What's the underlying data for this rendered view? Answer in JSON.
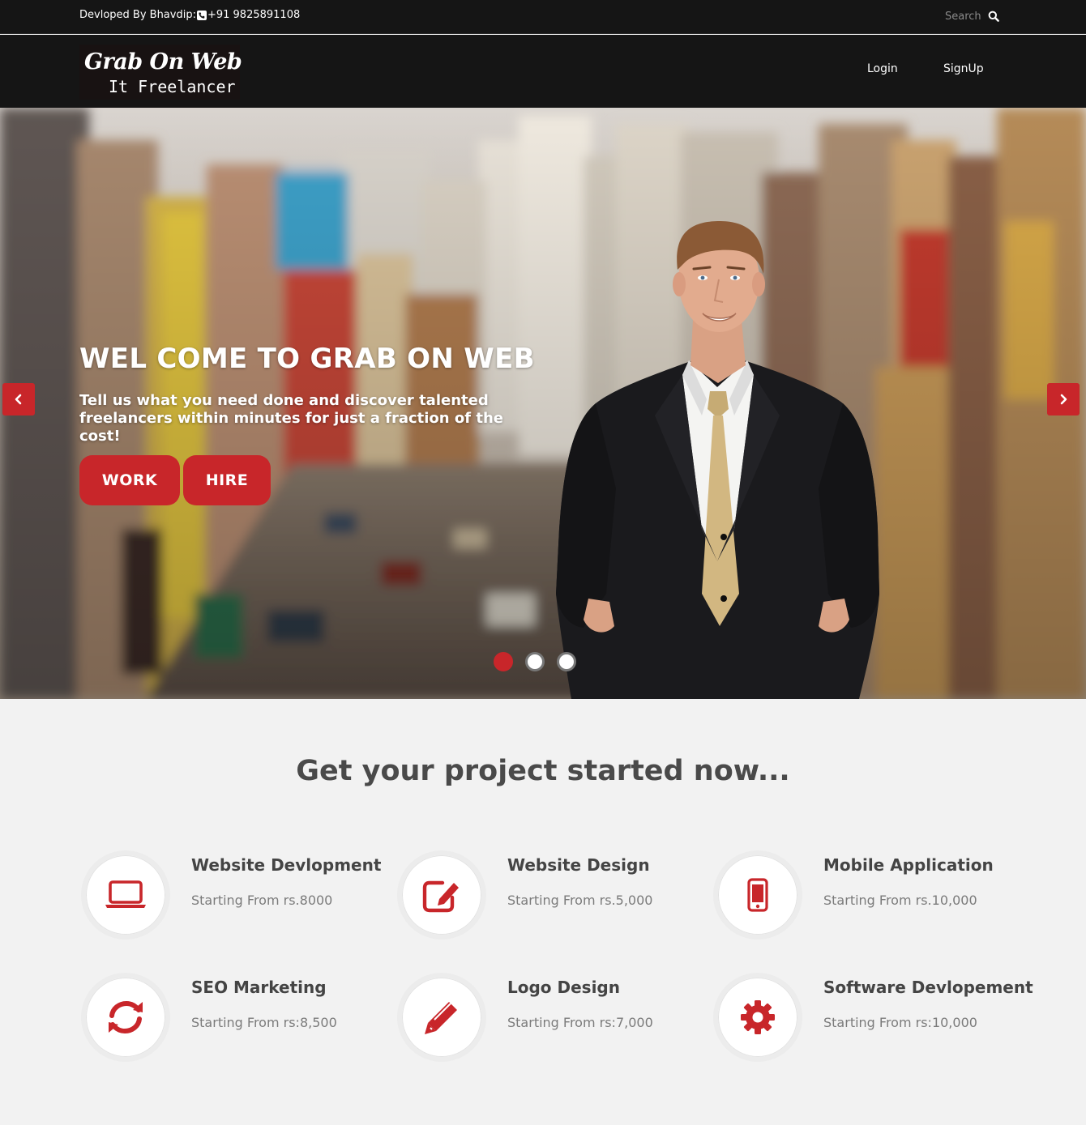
{
  "topbar": {
    "dev_label": "Devloped By Bhavdip:",
    "phone": "+91 9825891108",
    "search_placeholder": "Search"
  },
  "brand": {
    "line1": "Grab On Web",
    "line2": "It Freelancer"
  },
  "nav": {
    "login": "Login",
    "signup": "SignUp"
  },
  "hero": {
    "title": "WEL COME TO GRAB ON WEB",
    "subtitle": "Tell us what you need done and discover talented freelancers within minutes for just a fraction of the cost!",
    "work_button": "WORK",
    "hire_button": "HIRE",
    "active_slide": 1,
    "slide_count": 3
  },
  "services": {
    "title": "Get your project started now...",
    "items": [
      {
        "name": "Website Devlopment",
        "price": "Starting From rs.8000",
        "icon": "laptop-icon"
      },
      {
        "name": "Website Design",
        "price": "Starting From rs.5,000",
        "icon": "edit-icon"
      },
      {
        "name": "Mobile Application",
        "price": "Starting From rs.10,000",
        "icon": "mobile-icon"
      },
      {
        "name": "SEO Marketing",
        "price": "Starting From rs:8,500",
        "icon": "refresh-icon"
      },
      {
        "name": "Logo Design",
        "price": "Starting From rs:7,000",
        "icon": "pencil-icon"
      },
      {
        "name": "Software Devlopement",
        "price": "Starting From rs:10,000",
        "icon": "gear-icon"
      }
    ]
  },
  "colors": {
    "accent": "#c8262a",
    "topbar": "#151515",
    "section_bg": "#f2f2f2"
  }
}
